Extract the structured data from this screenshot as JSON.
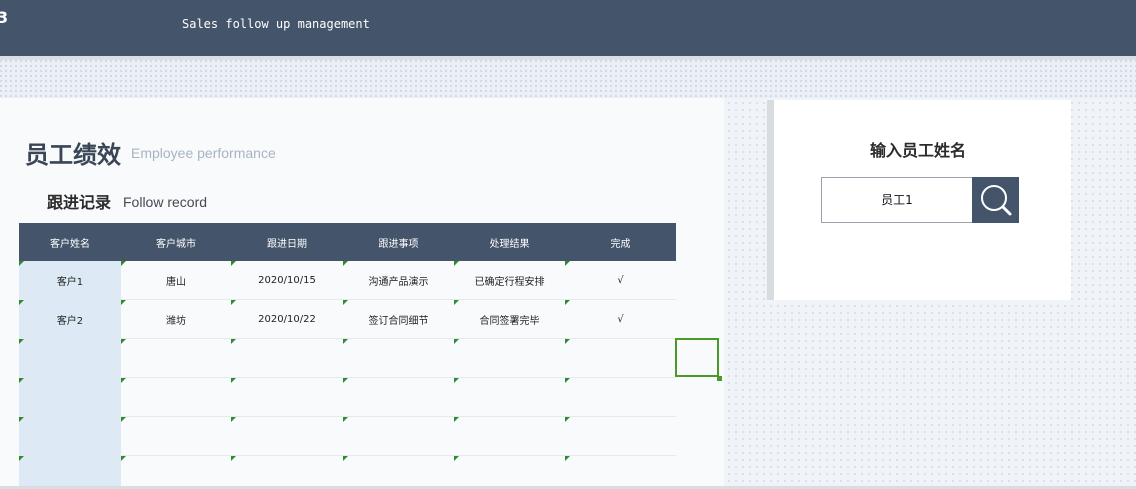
{
  "header": {
    "edge_glyph": "3",
    "title": "Sales follow up management"
  },
  "performance": {
    "title": "员工绩效",
    "subtitle": "Employee performance"
  },
  "follow_record": {
    "title": "跟进记录",
    "subtitle": "Follow record",
    "columns": [
      "客户姓名",
      "客户城市",
      "跟进日期",
      "跟进事项",
      "处理结果",
      "完成"
    ],
    "rows": [
      [
        "客户1",
        "唐山",
        "2020/10/15",
        "沟通产品演示",
        "已确定行程安排",
        "√"
      ],
      [
        "客户2",
        "潍坊",
        "2020/10/22",
        "签订合同细节",
        "合同签署完毕",
        "√"
      ],
      [
        "",
        "",
        "",
        "",
        "",
        ""
      ],
      [
        "",
        "",
        "",
        "",
        "",
        ""
      ],
      [
        "",
        "",
        "",
        "",
        "",
        ""
      ],
      [
        "",
        "",
        "",
        "",
        "",
        ""
      ]
    ]
  },
  "employee_search": {
    "label": "输入员工姓名",
    "value": "员工1",
    "button_icon": "search-icon"
  }
}
